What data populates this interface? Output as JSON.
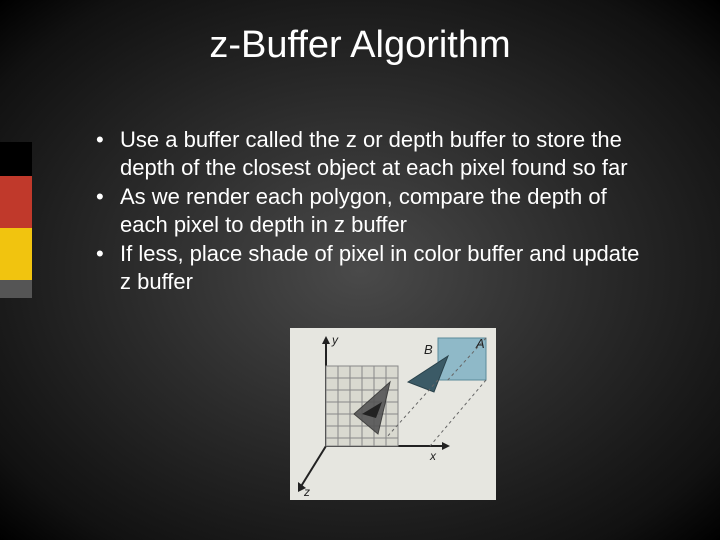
{
  "title": "z-Buffer Algorithm",
  "bullets": [
    "Use a buffer called the z or depth buffer to store the depth of the closest object at each pixel found so far",
    "As we render each polygon, compare the depth of each pixel to depth in z buffer",
    "If less, place shade of pixel in color buffer and update z buffer"
  ],
  "diagram": {
    "axis_y": "y",
    "axis_x": "x",
    "axis_z": "z",
    "label_A": "A",
    "label_B": "B"
  },
  "accent_colors": [
    "#000000",
    "#c0392b",
    "#f1c40f",
    "#555555"
  ]
}
